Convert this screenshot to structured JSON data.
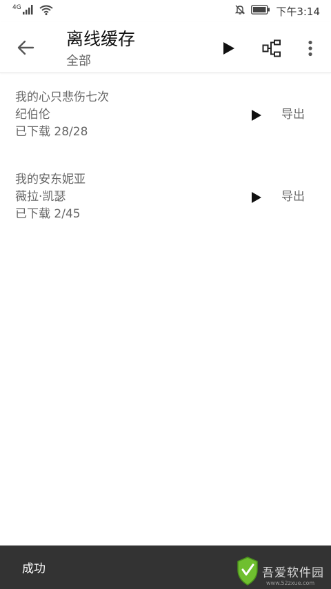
{
  "status_bar": {
    "network": "4G",
    "time": "下午3:14"
  },
  "app_bar": {
    "title": "离线缓存",
    "subtitle": "全部"
  },
  "downloads": [
    {
      "title": "我的心只悲伤七次",
      "artist": "纪伯伦",
      "progress": "已下载 28/28",
      "export_label": "导出"
    },
    {
      "title": "我的安东妮亚",
      "artist": "薇拉·凯瑟",
      "progress": "已下载 2/45",
      "export_label": "导出"
    }
  ],
  "snackbar": {
    "message": "成功"
  },
  "watermark": {
    "main": "吾爱软件园",
    "sub": "www.52zxue.com"
  },
  "colors": {
    "snackbar_bg": "#333333",
    "text_primary": "#111111",
    "text_secondary": "#666666",
    "watermark_green": "#6fbf2f"
  }
}
